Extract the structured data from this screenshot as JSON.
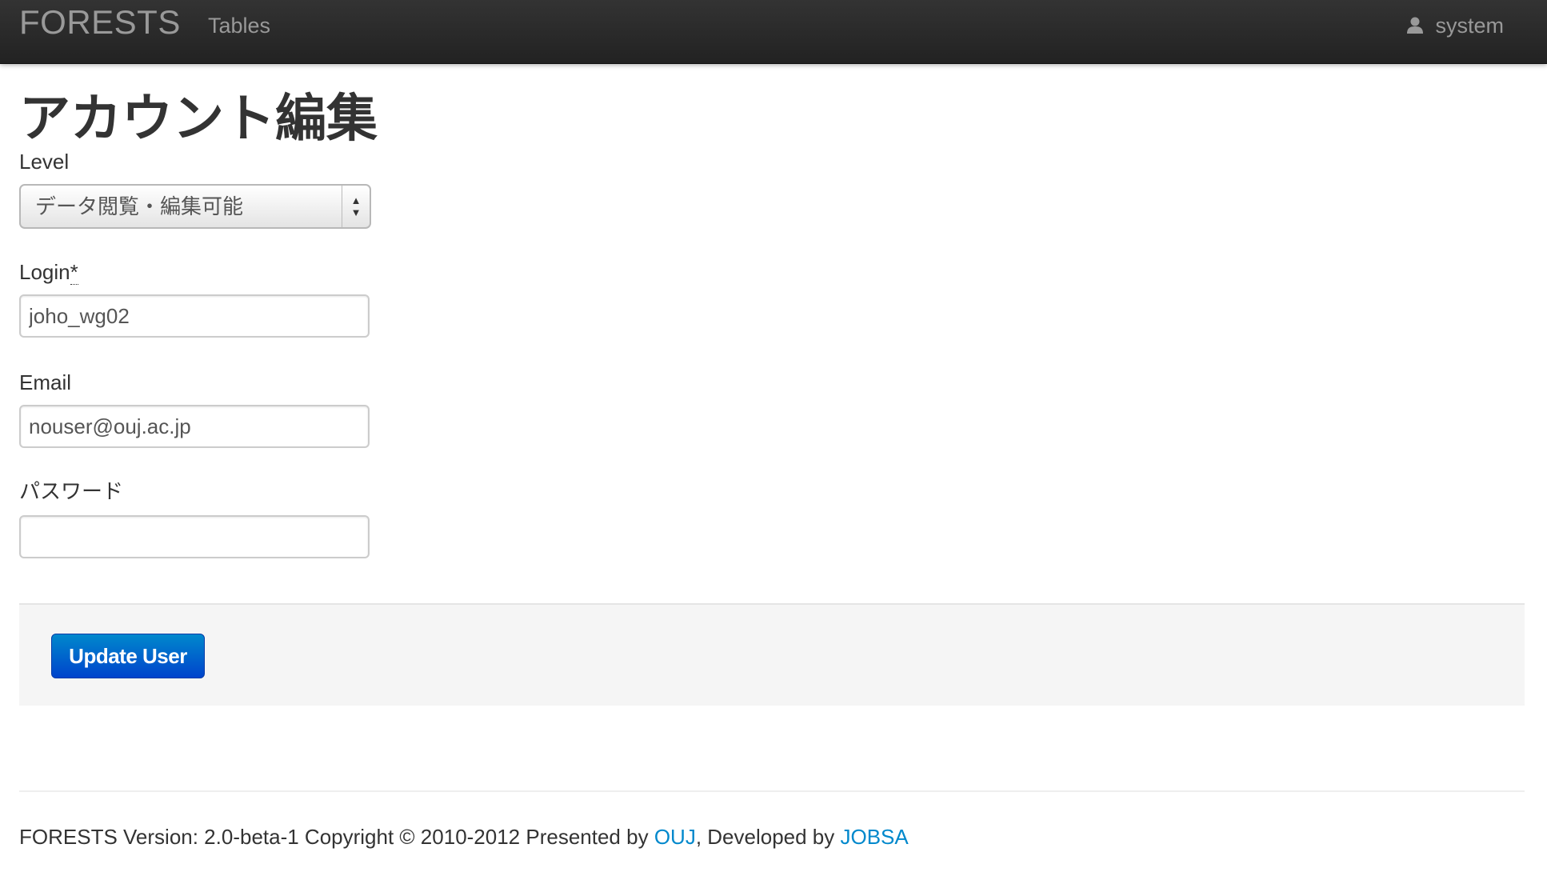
{
  "navbar": {
    "brand": "FORESTS",
    "links": [
      {
        "label": "Tables"
      }
    ],
    "user": {
      "icon": "user-icon",
      "name": "system"
    }
  },
  "page": {
    "title": "アカウント編集"
  },
  "form": {
    "level": {
      "label": "Level",
      "selected": "データ閲覧・編集可能"
    },
    "login": {
      "label": "Login",
      "required_mark": "*",
      "value": "joho_wg02"
    },
    "email": {
      "label": "Email",
      "value": "nouser@ouj.ac.jp"
    },
    "password": {
      "label": "パスワード",
      "value": ""
    },
    "submit_label": "Update User"
  },
  "footer": {
    "text_before": "FORESTS Version: 2.0-beta-1 Copyright © 2010-2012 Presented by ",
    "link1": "OUJ",
    "text_middle": ", Developed by ",
    "link2": "JOBSA"
  },
  "colors": {
    "navbar": "#222222",
    "primary": "#0088cc",
    "link": "#0088cc"
  }
}
